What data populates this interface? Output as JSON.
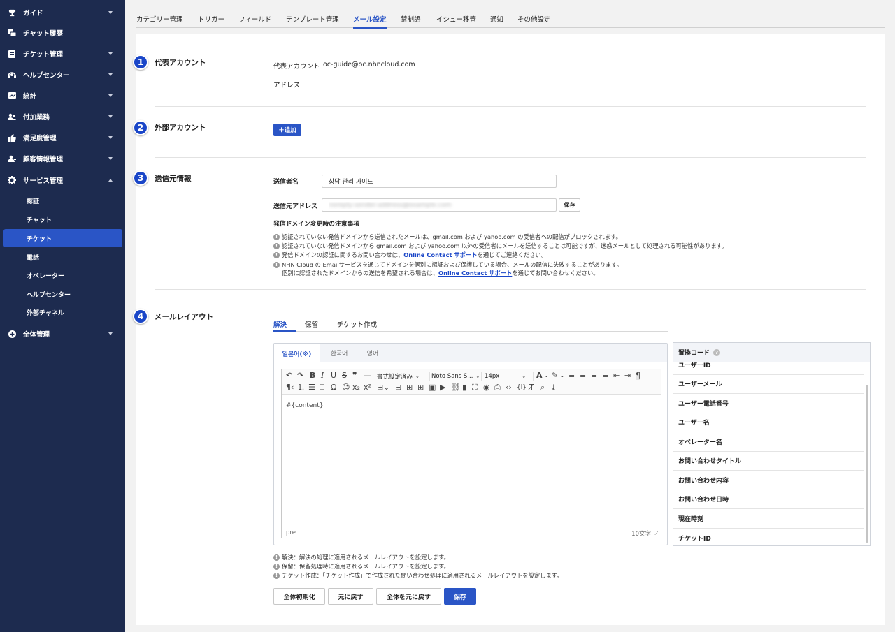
{
  "sidebar": {
    "items": [
      {
        "label": "ガイド",
        "icon": "trophy-icon",
        "expandable": true
      },
      {
        "label": "チャット履歴",
        "icon": "chat-icon",
        "expandable": false
      },
      {
        "label": "チケット管理",
        "icon": "ticket-icon",
        "expandable": true
      },
      {
        "label": "ヘルプセンター",
        "icon": "headset-icon",
        "expandable": true
      },
      {
        "label": "統計",
        "icon": "chart-icon",
        "expandable": true
      },
      {
        "label": "付加業務",
        "icon": "users-icon",
        "expandable": true
      },
      {
        "label": "満足度管理",
        "icon": "thumbs-up-icon",
        "expandable": true
      },
      {
        "label": "顧客情報管理",
        "icon": "user-card-icon",
        "expandable": true
      },
      {
        "label": "サービス管理",
        "icon": "gear-icon",
        "expandable": true,
        "expanded": true
      },
      {
        "label": "全体管理",
        "icon": "plus-circle-icon",
        "expandable": true
      }
    ],
    "sub_items": [
      "認証",
      "チャット",
      "チケット",
      "電話",
      "オペレーター",
      "ヘルプセンター",
      "外部チャネル"
    ],
    "active_sub": "チケット"
  },
  "tabs": [
    "カテゴリー管理",
    "トリガー",
    "フィールド",
    "テンプレート管理",
    "メール設定",
    "禁制語",
    "イシュー移管",
    "通知",
    "その他設定"
  ],
  "active_tab": "メール設定",
  "sections": {
    "rep": {
      "number": "1",
      "title": "代表アカウント",
      "account_label": "代表アカウント",
      "account_value": "oc-guide@oc.nhncloud.com",
      "address_label": "アドレス"
    },
    "external": {
      "number": "2",
      "title": "外部アカウント",
      "add_button": "＋追加"
    },
    "sender": {
      "number": "3",
      "title": "送信元情報",
      "name_label": "送信者名",
      "name_value": "상담 관리 가이드",
      "address_label": "送信元アドレス",
      "address_value": "noreply-sender-address@example.com",
      "save_button": "保存",
      "notice_title": "発信ドメイン変更時の注意事項",
      "notices": [
        {
          "text": "認証されていない発信ドメインから送信されたメールは、gmail.com および yahoo.com の受信者への配信がブロックされます。"
        },
        {
          "text": "認証されていない発信ドメインから gmail.com および yahoo.com 以外の受信者にメールを送信することは可能ですが、迷惑メールとして処理される可能性があります。"
        },
        {
          "before": "発信ドメインの認証に関するお問い合わせは、",
          "link": "Online Contact サポート",
          "after": "を通じてご連絡ください。"
        },
        {
          "text": "NHN Cloud の Emailサービスを通じてドメインを個別に認証および保護している場合、メールの配信に失敗することがあります。"
        },
        {
          "before": "個別に認証されたドメインからの送信を希望される場合は、",
          "link": "Online Contact サポート",
          "after": "を通じてお問い合わせください。"
        }
      ]
    },
    "layout": {
      "number": "4",
      "title": "メールレイアウト",
      "tabs": [
        "解決",
        "保留",
        "チケット作成"
      ],
      "active_tab": "解決",
      "lang_tabs": [
        "일본어(※)",
        "한국어",
        "영어"
      ],
      "active_lang": "일본어(※)",
      "toolbar": {
        "format_select": "書式設定済み",
        "font_select": "Noto Sans S...",
        "size_select": "14px"
      },
      "content": "#{content}",
      "footer_tag": "pre",
      "char_count": "10文字",
      "code_title": "置換コード",
      "codes": [
        "ユーザーID",
        "ユーザーメール",
        "ユーザー電話番号",
        "ユーザー名",
        "オペレーター名",
        "お問い合わせタイトル",
        "お問い合わせ内容",
        "お問い合わせ日時",
        "現在時刻",
        "チケットID"
      ],
      "notes": [
        "解決：解決の処理に適用されるメールレイアウトを設定します。",
        "保留：保留処理時に適用されるメールレイアウトを設定します。",
        "チケット作成：「チケット作成」で作成された問い合わせ処理に適用されるメールレイアウトを設定します。"
      ],
      "buttons": {
        "reset_all": "全体初期化",
        "undo": "元に戻す",
        "undo_all": "全体を元に戻す",
        "save": "保存"
      }
    }
  },
  "colors": {
    "sidebar_bg": "#1d2b4f",
    "accent": "#2a55c6",
    "badge": "#1a46c8"
  }
}
